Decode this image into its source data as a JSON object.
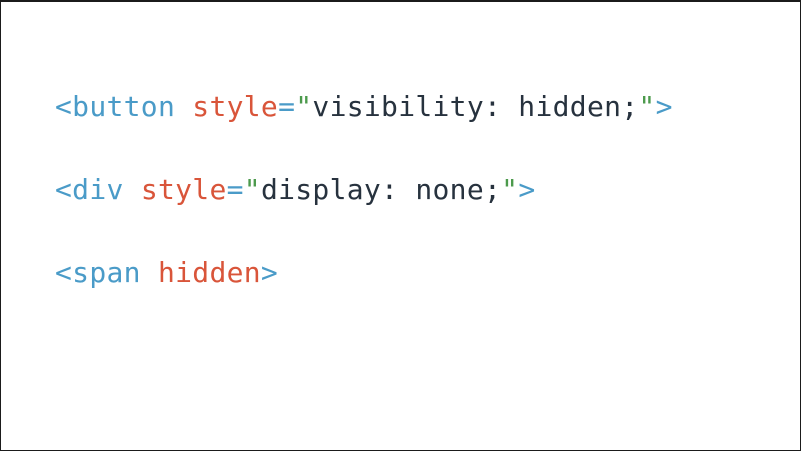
{
  "colors": {
    "tag": "#4a9bc8",
    "attribute": "#d9553a",
    "string_quote": "#4c9a4c",
    "value_text": "#27323e",
    "background": "#ffffff"
  },
  "lines": [
    {
      "open": "<button",
      "attr": "style",
      "eq": "=",
      "quote_open": "\"",
      "value": "visibility: hidden;",
      "quote_close": "\"",
      "close": ">"
    },
    {
      "open": "<div",
      "attr": "style",
      "eq": "=",
      "quote_open": "\"",
      "value": "display: none;",
      "quote_close": "\"",
      "close": ">"
    },
    {
      "open": "<span",
      "attr": "hidden",
      "close": ">"
    }
  ]
}
